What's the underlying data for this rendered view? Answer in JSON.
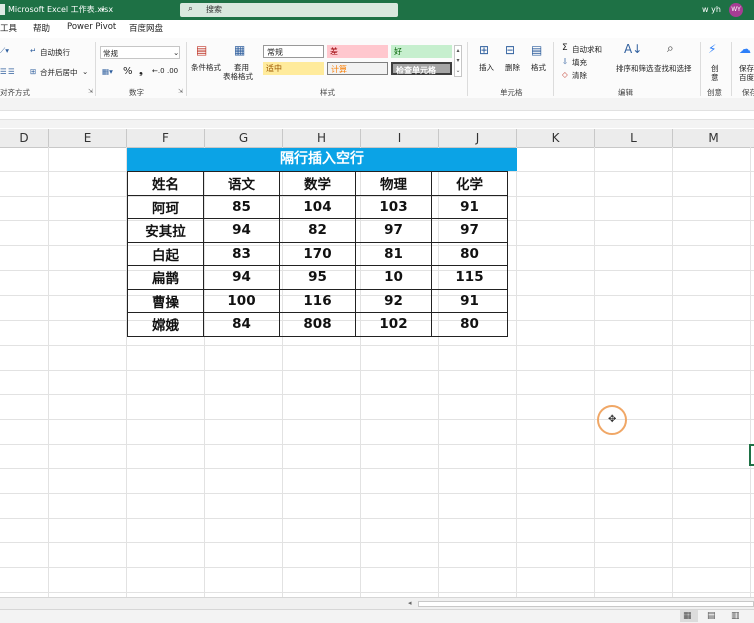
{
  "titlebar": {
    "title": "Microsoft Excel 工作表.xlsx",
    "search_label": "搜索",
    "user_name": "w yh",
    "avatar_initials": "WY"
  },
  "menu": {
    "items": [
      "工具",
      "帮助",
      "Power Pivot",
      "百度网盘"
    ]
  },
  "ribbon": {
    "wrap_text": "自动换行",
    "merge_center": "合并后居中",
    "align_group": "对齐方式",
    "number_format": "常规",
    "number_group": "数字",
    "conditional_format": "条件格式",
    "table_format_1": "套用",
    "table_format_2": "表格格式",
    "style_normal": "常规",
    "style_bad": "差",
    "style_good": "好",
    "style_neutral": "适中",
    "style_calc": "计算",
    "style_check": "检查单元格",
    "styles_group": "样式",
    "insert": "插入",
    "delete": "删除",
    "format": "格式",
    "cells_group": "单元格",
    "autosum": "自动求和",
    "fill": "填充",
    "clear": "清除",
    "sort_filter": "排序和筛选",
    "find_select": "查找和选择",
    "editing_group": "编辑",
    "create_1": "创",
    "create_2": "意",
    "create_group": "创意",
    "save_1": "保存",
    "save_2": "百度",
    "save_group": "保存"
  },
  "columns": [
    "D",
    "E",
    "F",
    "G",
    "H",
    "I",
    "J",
    "K",
    "L",
    "M"
  ],
  "table": {
    "title": "隔行插入空行",
    "headers": [
      "姓名",
      "语文",
      "数学",
      "物理",
      "化学"
    ],
    "rows": [
      [
        "阿珂",
        "85",
        "104",
        "103",
        "91"
      ],
      [
        "安其拉",
        "94",
        "82",
        "97",
        "97"
      ],
      [
        "白起",
        "83",
        "170",
        "81",
        "80"
      ],
      [
        "扁鹊",
        "94",
        "95",
        "10",
        "115"
      ],
      [
        "曹操",
        "100",
        "116",
        "92",
        "91"
      ],
      [
        "嫦娥",
        "84",
        "808",
        "102",
        "80"
      ]
    ]
  },
  "colors": {
    "excel_green": "#1e7145",
    "table_title_bg": "#0ba3e6",
    "cursor_ring": "#f0a766"
  }
}
